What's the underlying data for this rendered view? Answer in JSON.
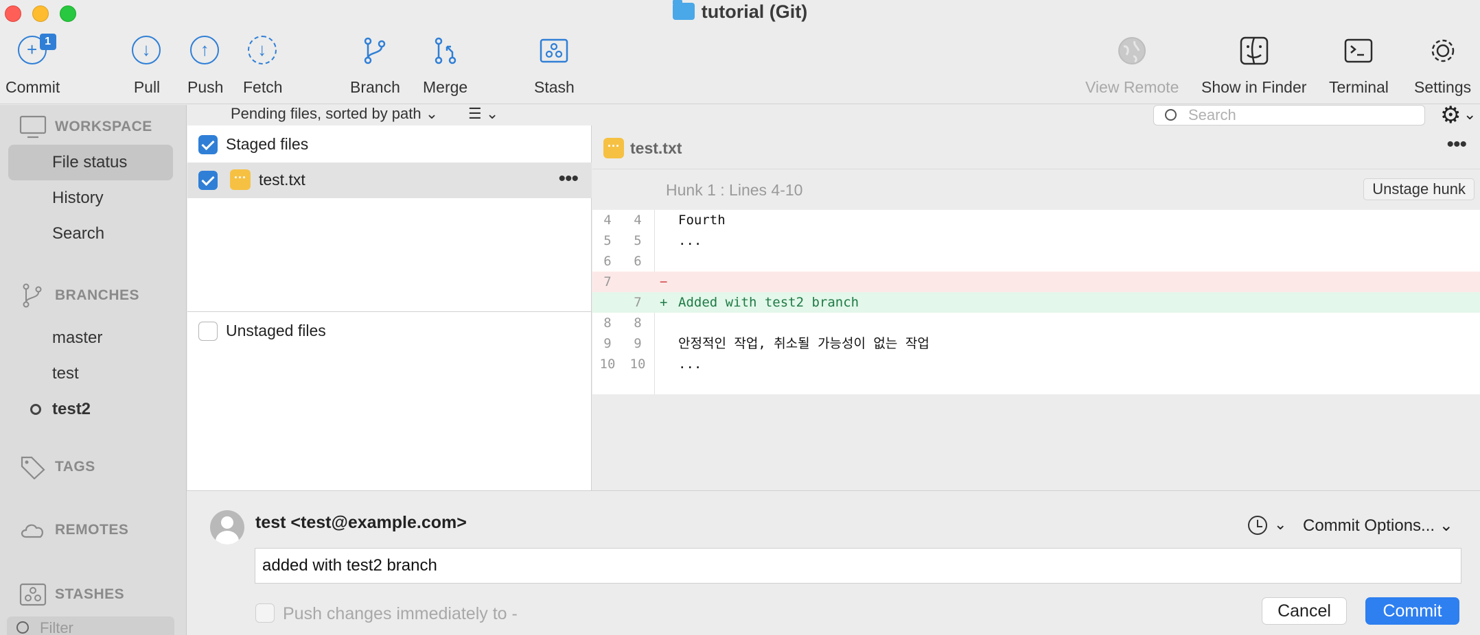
{
  "window": {
    "title": "tutorial (Git)"
  },
  "toolbar": {
    "commit": "Commit",
    "commit_badge": "1",
    "pull": "Pull",
    "push": "Push",
    "fetch": "Fetch",
    "branch": "Branch",
    "merge": "Merge",
    "stash": "Stash",
    "view_remote": "View Remote",
    "show_in_finder": "Show in Finder",
    "terminal": "Terminal",
    "settings": "Settings"
  },
  "sidebar": {
    "workspace": "WORKSPACE",
    "workspace_items": [
      "File status",
      "History",
      "Search"
    ],
    "branches": "BRANCHES",
    "branch_items": [
      "master",
      "test",
      "test2"
    ],
    "current_branch": "test2",
    "tags": "TAGS",
    "remotes": "REMOTES",
    "stashes": "STASHES",
    "filter_placeholder": "Filter"
  },
  "files": {
    "sort_label": "Pending files, sorted by path",
    "staged_label": "Staged files",
    "staged_files": [
      {
        "name": "test.txt",
        "checked": true
      }
    ],
    "unstaged_label": "Unstaged files"
  },
  "search": {
    "placeholder": "Search"
  },
  "diff": {
    "file": "test.txt",
    "hunk_title": "Hunk 1 : Lines 4-10",
    "unstage_hunk": "Unstage hunk",
    "lines": [
      {
        "old": "4",
        "new": "4",
        "marker": "",
        "text": "Fourth",
        "type": "ctx"
      },
      {
        "old": "5",
        "new": "5",
        "marker": "",
        "text": "...",
        "type": "ctx"
      },
      {
        "old": "6",
        "new": "6",
        "marker": "",
        "text": "",
        "type": "ctx"
      },
      {
        "old": "7",
        "new": "",
        "marker": "−",
        "text": "",
        "type": "del"
      },
      {
        "old": "",
        "new": "7",
        "marker": "+",
        "text": "Added with test2 branch",
        "type": "add"
      },
      {
        "old": "8",
        "new": "8",
        "marker": "",
        "text": "",
        "type": "ctx"
      },
      {
        "old": "9",
        "new": "9",
        "marker": "",
        "text": "안정적인 작업, 취소될 가능성이 없는 작업",
        "type": "ctx"
      },
      {
        "old": "10",
        "new": "10",
        "marker": "",
        "text": "...",
        "type": "ctx"
      }
    ]
  },
  "commit_panel": {
    "author": "test <test@example.com>",
    "options": "Commit Options...",
    "message": "added with test2 branch",
    "push_label": "Push changes immediately to -",
    "cancel": "Cancel",
    "commit": "Commit"
  }
}
